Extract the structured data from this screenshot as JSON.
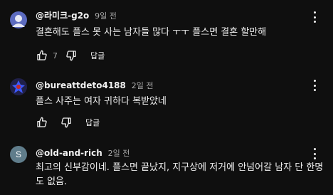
{
  "comments": [
    {
      "author": "@라미크-g2o",
      "time": "9일 전",
      "text": "결혼해도 플스 못 사는 남자들 많다 ㅜㅜ  플스면 결혼 할만해",
      "likes": "7",
      "reply_label": "답글",
      "avatar_color": "#5c6bc0",
      "avatar_icon": "person-icon"
    },
    {
      "author": "@bureattdeto4188",
      "time": "2일 전",
      "text": "플스 사주는 여자 귀하다 복받았네",
      "likes": "",
      "reply_label": "답글",
      "avatar_color": "#1a1a3a",
      "avatar_icon": "pattern-icon"
    },
    {
      "author": "@old-and-rich",
      "time": "2일 전",
      "text": "최고의 신부감이네. 플스면 끝났지, 지구상에 저거에 안넘어갈 남자 단 한명도 없음.",
      "likes": "",
      "reply_label": "답글",
      "avatar_color": "#607d8b",
      "avatar_letter": "S"
    }
  ],
  "icons": {
    "like": "thumb-up-icon",
    "dislike": "thumb-down-icon",
    "menu": "more-vert-icon"
  }
}
